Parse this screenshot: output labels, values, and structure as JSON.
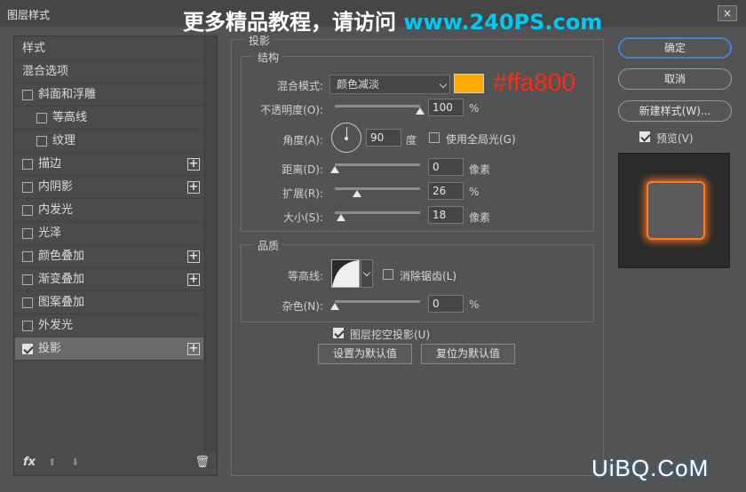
{
  "window": {
    "title": "图层样式",
    "close_symbol": "×"
  },
  "watermark": {
    "text_cn": "更多精品教程，请访问 ",
    "url": "www.240PS.com",
    "corner": "UiBQ.CoM"
  },
  "left": {
    "items": [
      {
        "label": "样式",
        "checkbox": false,
        "plus": false,
        "indent": 0
      },
      {
        "label": "混合选项",
        "checkbox": false,
        "plus": false,
        "indent": 0
      },
      {
        "label": "斜面和浮雕",
        "checkbox": true,
        "checked": false,
        "plus": false,
        "indent": 0
      },
      {
        "label": "等高线",
        "checkbox": true,
        "checked": false,
        "plus": false,
        "indent": 1
      },
      {
        "label": "纹理",
        "checkbox": true,
        "checked": false,
        "plus": false,
        "indent": 1
      },
      {
        "label": "描边",
        "checkbox": true,
        "checked": false,
        "plus": true,
        "indent": 0
      },
      {
        "label": "内阴影",
        "checkbox": true,
        "checked": false,
        "plus": true,
        "indent": 0
      },
      {
        "label": "内发光",
        "checkbox": true,
        "checked": false,
        "plus": false,
        "indent": 0
      },
      {
        "label": "光泽",
        "checkbox": true,
        "checked": false,
        "plus": false,
        "indent": 0
      },
      {
        "label": "颜色叠加",
        "checkbox": true,
        "checked": false,
        "plus": true,
        "indent": 0
      },
      {
        "label": "渐变叠加",
        "checkbox": true,
        "checked": false,
        "plus": true,
        "indent": 0
      },
      {
        "label": "图案叠加",
        "checkbox": true,
        "checked": false,
        "plus": false,
        "indent": 0
      },
      {
        "label": "外发光",
        "checkbox": true,
        "checked": false,
        "plus": false,
        "indent": 0
      },
      {
        "label": "投影",
        "checkbox": true,
        "checked": true,
        "plus": true,
        "indent": 0,
        "selected": true
      }
    ],
    "footer": {
      "fx": "fx",
      "up": "⬆",
      "down": "⬇",
      "trash": "🗑"
    }
  },
  "drop_shadow": {
    "section_title": "投影",
    "structure": {
      "title": "结构",
      "blend_mode_label": "混合模式:",
      "blend_mode_value": "颜色减淡",
      "color": "#ffa800",
      "color_hex_text": "#ffa800",
      "opacity_label": "不透明度(O):",
      "opacity_value": "100",
      "opacity_level": 100,
      "opacity_unit": "%",
      "angle_label": "角度(A):",
      "angle_value": "90",
      "angle_unit": "度",
      "global_light_label": "使用全局光(G)",
      "global_light_checked": false,
      "distance_label": "距离(D):",
      "distance_value": "0",
      "distance_level": 0,
      "distance_unit": "像素",
      "spread_label": "扩展(R):",
      "spread_value": "26",
      "spread_level": 26,
      "spread_unit": "%",
      "size_label": "大小(S):",
      "size_value": "18",
      "size_level": 7,
      "size_unit": "像素"
    },
    "quality": {
      "title": "品质",
      "contour_label": "等高线:",
      "anti_alias_label": "消除锯齿(L)",
      "anti_alias_checked": false,
      "noise_label": "杂色(N):",
      "noise_value": "0",
      "noise_level": 0,
      "noise_unit": "%"
    },
    "knockout_label": "图层挖空投影(U)",
    "knockout_checked": true,
    "set_default_label": "设置为默认值",
    "reset_default_label": "复位为默认值"
  },
  "right": {
    "ok_label": "确定",
    "cancel_label": "取消",
    "new_style_label": "新建样式(W)...",
    "preview_label": "预览(V)",
    "preview_checked": true
  }
}
